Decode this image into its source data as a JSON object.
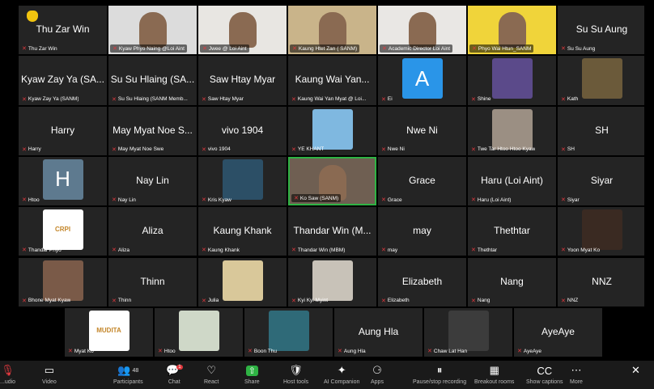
{
  "grid": {
    "tiles": [
      {
        "name": "Thu Zar Win",
        "label": "Thu Zar Win",
        "kind": "name",
        "hand": true
      },
      {
        "name": "",
        "label": "Kyaw Phyo Naing @Loi Aint",
        "kind": "video",
        "bg": "#dcdcdc"
      },
      {
        "name": "",
        "label": "Jwee @ Loi Aint",
        "kind": "video",
        "bg": "#e8e6e2"
      },
      {
        "name": "",
        "label": "Kaung Htet Zan ( SANM)",
        "kind": "video",
        "bg": "#c9b48a"
      },
      {
        "name": "",
        "label": "Academic Director Loi Aint",
        "kind": "video",
        "bg": "#e9e7e4"
      },
      {
        "name": "",
        "label": "Phyo Wai Htun_SANM",
        "kind": "video",
        "bg": "#f0d43a"
      },
      {
        "name": "Su Su Aung",
        "label": "Su Su Aung",
        "kind": "name"
      },
      {
        "name": "Kyaw Zay Ya (SA...",
        "label": "Kyaw Zay Ya (SANM)",
        "kind": "name"
      },
      {
        "name": "Su Su Hlaing (SA...",
        "label": "Su Su Hlaing (SANM Memb...",
        "kind": "name"
      },
      {
        "name": "Saw Htay Myar",
        "label": "Saw Htay Myar",
        "kind": "name"
      },
      {
        "name": "Kaung Wai Yan...",
        "label": "Kaung Wai Yan Myat @ Loi...",
        "kind": "name"
      },
      {
        "name": "",
        "label": "Ei",
        "kind": "letter",
        "letter": "A",
        "color": "#2a95e8"
      },
      {
        "name": "",
        "label": "Shine",
        "kind": "image",
        "color": "#5b4a8a"
      },
      {
        "name": "",
        "label": "Kath",
        "kind": "image",
        "color": "#6b5a3a"
      },
      {
        "name": "Harry",
        "label": "Harry",
        "kind": "name"
      },
      {
        "name": "May Myat Noe S...",
        "label": "May Myat Noe Swe",
        "kind": "name"
      },
      {
        "name": "vivo 1904",
        "label": "vivo 1904",
        "kind": "name"
      },
      {
        "name": "",
        "label": "YE KHANT",
        "kind": "image",
        "color": "#7fb8e0"
      },
      {
        "name": "Nwe Ni",
        "label": "Nwe Ni",
        "kind": "name"
      },
      {
        "name": "",
        "label": "Twe Tar Htoo Htoo Kyaw",
        "kind": "image",
        "color": "#9b8f83"
      },
      {
        "name": "SH",
        "label": "SH",
        "kind": "name"
      },
      {
        "name": "",
        "label": "Htoo",
        "kind": "letter",
        "letter": "H",
        "color": "#5e7a8f"
      },
      {
        "name": "Nay Lin",
        "label": "Nay Lin",
        "kind": "name"
      },
      {
        "name": "",
        "label": "Kris Kyaw",
        "kind": "image",
        "color": "#2c4f66"
      },
      {
        "name": "",
        "label": "Ko Saw (SANM)",
        "kind": "video",
        "bg": "#6f5f52",
        "active": true
      },
      {
        "name": "Grace",
        "label": "Grace",
        "kind": "name"
      },
      {
        "name": "Haru (Loi Aint)",
        "label": "Haru (Loi Aint)",
        "kind": "name"
      },
      {
        "name": "Siyar",
        "label": "Siyar",
        "kind": "name"
      },
      {
        "name": "",
        "label": "Thandar Phyo",
        "kind": "image",
        "color": "#ffffff",
        "logo": "CRPI"
      },
      {
        "name": "Aliza",
        "label": "Aliza",
        "kind": "name"
      },
      {
        "name": "Kaung Khank",
        "label": "Kaung Khank",
        "kind": "name"
      },
      {
        "name": "Thandar Win (M...",
        "label": "Thandar Win (MBM)",
        "kind": "name"
      },
      {
        "name": "may",
        "label": "may",
        "kind": "name"
      },
      {
        "name": "Thethtar",
        "label": "Thethtar",
        "kind": "name"
      },
      {
        "name": "",
        "label": "Yoon Myat Ko",
        "kind": "image",
        "color": "#3a2a22"
      },
      {
        "name": "",
        "label": "Bhone Myat Kyaw",
        "kind": "image",
        "color": "#7a5a48"
      },
      {
        "name": "Thinn",
        "label": "Thinn",
        "kind": "name"
      },
      {
        "name": "",
        "label": "Julia",
        "kind": "image",
        "color": "#d9c89a"
      },
      {
        "name": "",
        "label": "Kyi Kyi Myint",
        "kind": "image",
        "color": "#c8c2b8"
      },
      {
        "name": "Elizabeth",
        "label": "Elizabeth",
        "kind": "name"
      },
      {
        "name": "Nang",
        "label": "Nang",
        "kind": "name"
      },
      {
        "name": "NNZ",
        "label": "NNZ",
        "kind": "name"
      },
      {
        "name": "",
        "label": "Myat Ko",
        "kind": "image",
        "color": "#ffffff",
        "logo": "MUDITA"
      },
      {
        "name": "",
        "label": "Htoo",
        "kind": "image",
        "color": "#cfd8c8"
      },
      {
        "name": "",
        "label": "Boon Thu",
        "kind": "image",
        "color": "#2f6a78"
      },
      {
        "name": "Aung Hla",
        "label": "Aung Hla",
        "kind": "name"
      },
      {
        "name": "",
        "label": "Chaw Lat Han",
        "kind": "image",
        "color": "#3c3c3c"
      },
      {
        "name": "AyeAye",
        "label": "AyeAye",
        "kind": "name"
      }
    ]
  },
  "toolbar": {
    "items": [
      {
        "icon": "mic-muted-icon",
        "label": "...udio",
        "glyph": "🎙"
      },
      {
        "icon": "video-icon",
        "label": "Video",
        "glyph": "▭"
      },
      {
        "icon": "participants-icon",
        "label": "Participants",
        "glyph": "👥",
        "count": "48"
      },
      {
        "icon": "chat-icon",
        "label": "Chat",
        "glyph": "💬",
        "badge": "1"
      },
      {
        "icon": "react-icon",
        "label": "React",
        "glyph": "♡"
      },
      {
        "icon": "share-icon",
        "label": "Share",
        "glyph": "⇧"
      },
      {
        "icon": "host-tools-icon",
        "label": "Host tools",
        "glyph": "🛡"
      },
      {
        "icon": "ai-companion-icon",
        "label": "AI Companion",
        "glyph": "✦"
      },
      {
        "icon": "apps-icon",
        "label": "Apps",
        "glyph": "⚆"
      },
      {
        "icon": "pause-recording-icon",
        "label": "Pause/stop recording",
        "glyph": "⏸"
      },
      {
        "icon": "breakout-rooms-icon",
        "label": "Breakout rooms",
        "glyph": "▦"
      },
      {
        "icon": "captions-icon",
        "label": "Show captions",
        "glyph": "CC"
      },
      {
        "icon": "more-icon",
        "label": "More",
        "glyph": "⋯"
      },
      {
        "icon": "leave-icon",
        "label": "",
        "glyph": "✕"
      }
    ]
  },
  "colors": {
    "mic_muted": "#e0393e",
    "active_speaker": "#2fb344",
    "tile_bg": "#242424"
  }
}
